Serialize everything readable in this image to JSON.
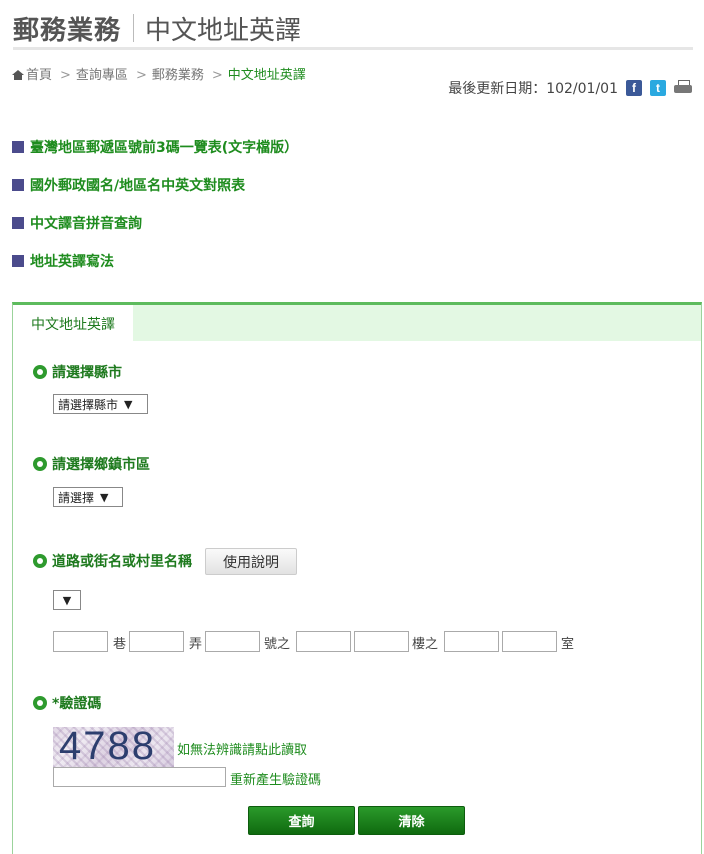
{
  "header": {
    "site_title": "郵務業務",
    "page_title": "中文地址英譯"
  },
  "breadcrumb": {
    "home": "首頁",
    "items": [
      "查詢專區",
      "郵務業務",
      "中文地址英譯"
    ]
  },
  "update": {
    "label": "最後更新日期：102/01/01",
    "icons": [
      "facebook-icon",
      "twitter-icon",
      "print-icon"
    ]
  },
  "links": [
    "臺灣地區郵遞區號前3碼一覽表(文字檔版）",
    "國外郵政國名/地區名中英文對照表",
    "中文譯音拼音查詢",
    "地址英譯寫法"
  ],
  "panel": {
    "tab_label": "中文地址英譯",
    "county": {
      "label": "請選擇縣市",
      "selected": "請選擇縣市"
    },
    "district": {
      "label": "請選擇鄉鎮市區",
      "selected": "請選擇"
    },
    "road": {
      "label": "道路或街名或村里名稱",
      "help_button": "使用說明",
      "selected": ""
    },
    "address_units": {
      "lane": "巷",
      "alley": "弄",
      "number_of": "號之",
      "floor_of": "樓之",
      "room": "室"
    },
    "captcha": {
      "label": "*驗證碼",
      "code": "4788",
      "unreadable_link": "如無法辨識請點此讀取",
      "regenerate_link": "重新產生驗證碼"
    },
    "buttons": {
      "query": "查詢",
      "clear": "清除"
    }
  },
  "colors": {
    "accent_green": "#1e8c1e",
    "tab_background": "#e3f8e3",
    "bullet": "#4b4b8c",
    "button_green": "#0f6a0f"
  }
}
